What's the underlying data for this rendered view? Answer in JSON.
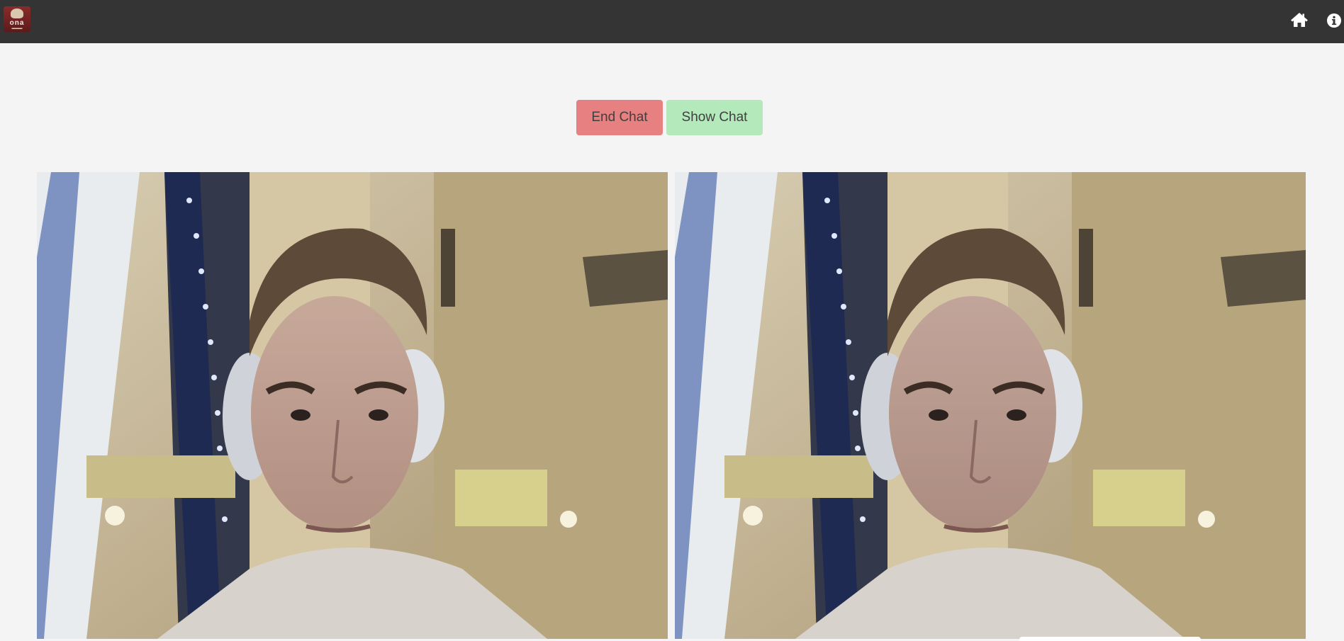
{
  "navbar": {
    "logo": {
      "text": "ona",
      "icon": "logo-icon"
    },
    "icons": [
      "home-icon",
      "info-icon"
    ]
  },
  "controls": {
    "end_chat_label": "End Chat",
    "show_chat_label": "Show Chat"
  },
  "colors": {
    "navbar_bg": "#343434",
    "page_bg": "#f4f4f4",
    "end_button": "#e68081",
    "show_button": "#b4eabb"
  },
  "videos": {
    "local": "webcam-video",
    "remote": "webcam-video"
  }
}
